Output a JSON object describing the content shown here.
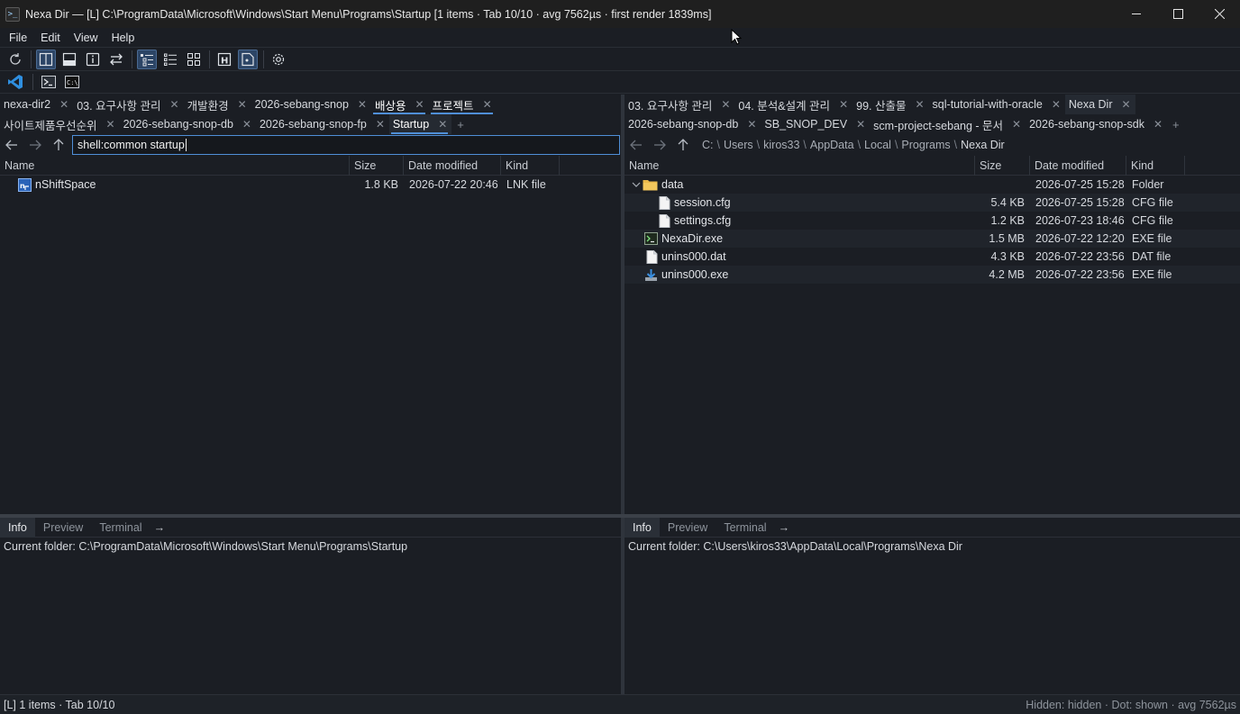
{
  "titlebar": {
    "title": "Nexa Dir — [L] C:\\ProgramData\\Microsoft\\Windows\\Start Menu\\Programs\\Startup [1 items · Tab 10/10 · avg 7562µs · first render 1839ms]",
    "minimize": "—",
    "maximize": "☐",
    "close": "✕"
  },
  "menu": [
    "File",
    "Edit",
    "View",
    "Help"
  ],
  "left": {
    "tabs_row1": [
      {
        "label": "nexa-dir2"
      },
      {
        "label": "03. 요구사항 관리"
      },
      {
        "label": "개발환경"
      },
      {
        "label": "2026-sebang-snop"
      },
      {
        "label": "배상용"
      },
      {
        "label": "프로젝트"
      }
    ],
    "tabs_row2": [
      {
        "label": "사이트제품우선순위"
      },
      {
        "label": "2026-sebang-snop-db"
      },
      {
        "label": "2026-sebang-snop-fp"
      },
      {
        "label": "Startup"
      }
    ],
    "path": "shell:common startup",
    "columns": {
      "name": "Name",
      "size": "Size",
      "date": "Date modified",
      "kind": "Kind"
    },
    "rows": [
      {
        "name": "nShiftSpace",
        "size": "1.8 KB",
        "date": "2026-07-22 20:46",
        "kind": "LNK file"
      }
    ]
  },
  "right": {
    "tabs_row1": [
      {
        "label": "03. 요구사항 관리"
      },
      {
        "label": "04. 분석&설계 관리"
      },
      {
        "label": "99. 산출물"
      },
      {
        "label": "sql-tutorial-with-oracle"
      },
      {
        "label": "Nexa Dir"
      }
    ],
    "tabs_row2": [
      {
        "label": "2026-sebang-snop-db"
      },
      {
        "label": "SB_SNOP_DEV"
      },
      {
        "label": "scm-project-sebang - 문서"
      },
      {
        "label": "2026-sebang-snop-sdk"
      }
    ],
    "breadcrumb": [
      "C:",
      "Users",
      "kiros33",
      "AppData",
      "Local",
      "Programs",
      "Nexa Dir"
    ],
    "columns": {
      "name": "Name",
      "size": "Size",
      "date": "Date modified",
      "kind": "Kind"
    },
    "rows": [
      {
        "name": "data",
        "size": "",
        "date": "2026-07-25 15:28",
        "kind": "Folder",
        "icon": "folder"
      },
      {
        "name": "session.cfg",
        "size": "5.4 KB",
        "date": "2026-07-25 15:28",
        "kind": "CFG file",
        "icon": "file"
      },
      {
        "name": "settings.cfg",
        "size": "1.2 KB",
        "date": "2026-07-23 18:46",
        "kind": "CFG file",
        "icon": "file"
      },
      {
        "name": "NexaDir.exe",
        "size": "1.5 MB",
        "date": "2026-07-22 12:20",
        "kind": "EXE file",
        "icon": "exe"
      },
      {
        "name": "unins000.dat",
        "size": "4.3 KB",
        "date": "2026-07-22 23:56",
        "kind": "DAT file",
        "icon": "file"
      },
      {
        "name": "unins000.exe",
        "size": "4.2 MB",
        "date": "2026-07-22 23:56",
        "kind": "EXE file",
        "icon": "installer"
      }
    ]
  },
  "bottom": {
    "tabs": [
      "Info",
      "Preview",
      "Terminal"
    ],
    "arrow": "→",
    "left_info": "Current folder: C:\\ProgramData\\Microsoft\\Windows\\Start Menu\\Programs\\Startup",
    "right_info": "Current folder: C:\\Users\\kiros33\\AppData\\Local\\Programs\\Nexa Dir"
  },
  "status": {
    "left": "[L] 1 items · Tab 10/10",
    "right": "Hidden: hidden · Dot: shown · avg 7562µs"
  },
  "colors": {
    "accent": "#4f8fd8",
    "folder": "#e8b84a",
    "background": "#1b1e24"
  }
}
